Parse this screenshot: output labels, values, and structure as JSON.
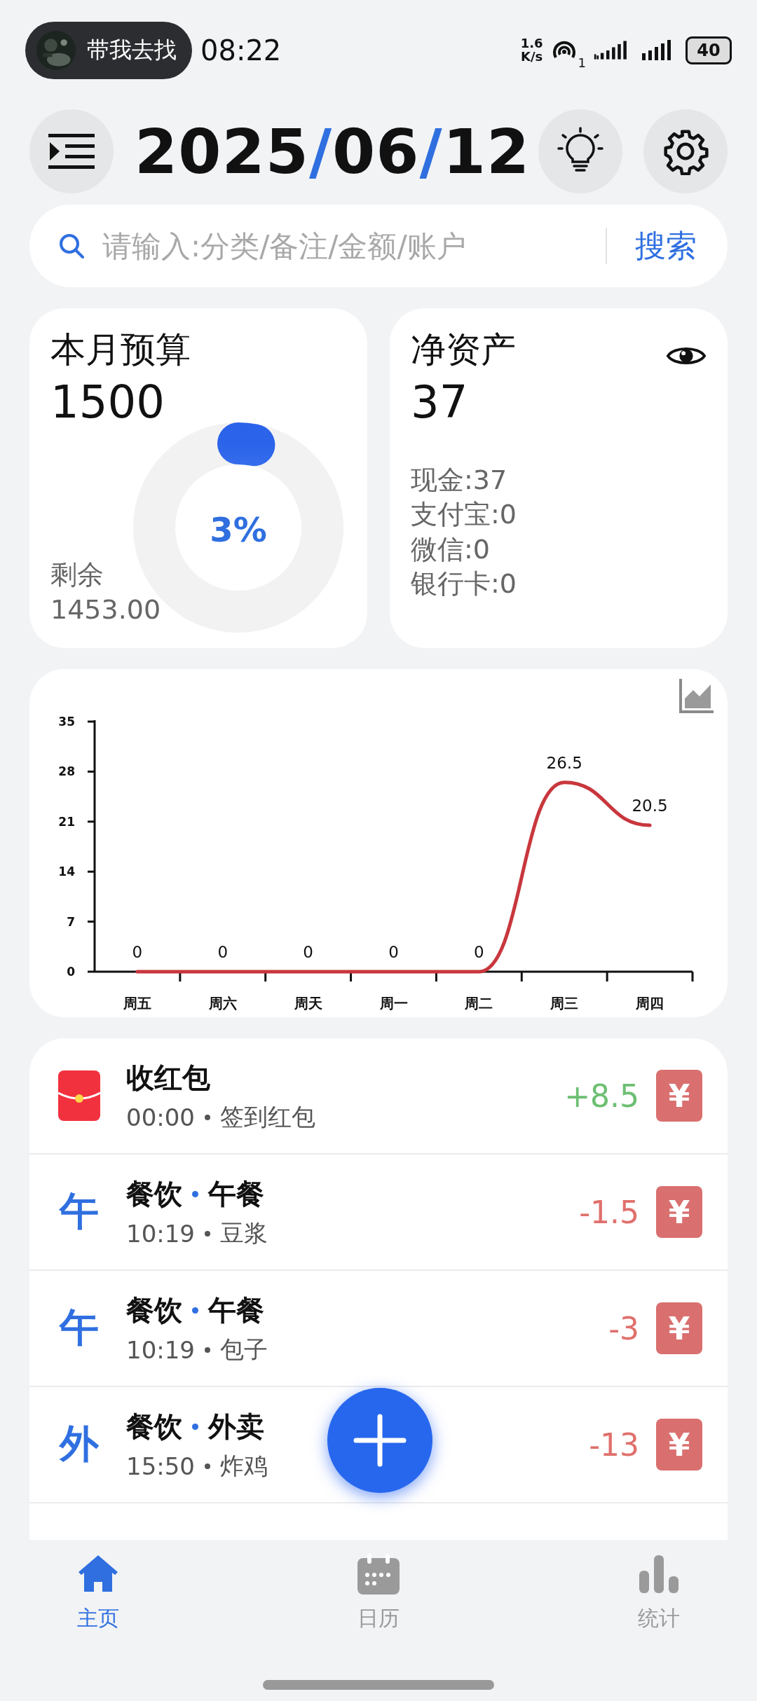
{
  "status_bar": {
    "notification": {
      "text": "带我去找"
    },
    "time": "08:22",
    "net_speed": {
      "value": "1.6",
      "unit": "K/s"
    },
    "hotspot_count": "1",
    "battery": "40"
  },
  "header": {
    "date": [
      {
        "text": "2025",
        "kind": "digits"
      },
      {
        "text": "/",
        "kind": "separator"
      },
      {
        "text": "06",
        "kind": "digits"
      },
      {
        "text": "/",
        "kind": "separator"
      },
      {
        "text": "12",
        "kind": "digits"
      }
    ]
  },
  "search": {
    "placeholder": "请输入:分类/备注/金额/账户",
    "button": "搜索"
  },
  "budget": {
    "title": "本月预算",
    "amount": "1500",
    "percent": "3%",
    "level": 0.03,
    "remaining_label": "剩余",
    "remaining": "1453.00"
  },
  "assets": {
    "title": "净资产",
    "amount": "37",
    "accounts": [
      "现金:37",
      "支付宝:0",
      "微信:0",
      "银行卡:0"
    ]
  },
  "trend": {
    "chart_data": {
      "type": "line",
      "categories": [
        "周五",
        "周六",
        "周天",
        "周一",
        "周二",
        "周三",
        "周四"
      ],
      "series": [
        {
          "color": "#c8373d",
          "values": [
            0,
            0,
            0,
            0,
            0,
            26.5,
            20.5
          ]
        }
      ],
      "ylim": [
        0,
        35
      ],
      "yticks": [
        0,
        7,
        14,
        21,
        28,
        35
      ],
      "data_labels": true
    }
  },
  "transactions": [
    {
      "kind": "red_packet",
      "title": "收红包",
      "time": "00:00",
      "note": "签到红包",
      "amount": "+8.5",
      "color": "#6cbf72",
      "badge": "¥"
    },
    {
      "kind": "letter",
      "icon_char": "午",
      "title": "餐饮",
      "subcategory": "午餐",
      "time": "10:19",
      "note": "豆浆",
      "amount": "-1.5",
      "color": "#e0706c",
      "badge": "¥"
    },
    {
      "kind": "letter",
      "icon_char": "午",
      "title": "餐饮",
      "subcategory": "午餐",
      "time": "10:19",
      "note": "包子",
      "amount": "-3",
      "color": "#e0706c",
      "badge": "¥"
    },
    {
      "kind": "letter",
      "icon_char": "外",
      "title": "餐饮",
      "subcategory": "外卖",
      "time": "15:50",
      "note": "炸鸡",
      "amount": "-13",
      "color": "#e0706c",
      "badge": "¥"
    }
  ],
  "nav": [
    {
      "label": "主页",
      "selected": true
    },
    {
      "label": "日历",
      "selected": false
    },
    {
      "label": "统计",
      "selected": false
    }
  ]
}
